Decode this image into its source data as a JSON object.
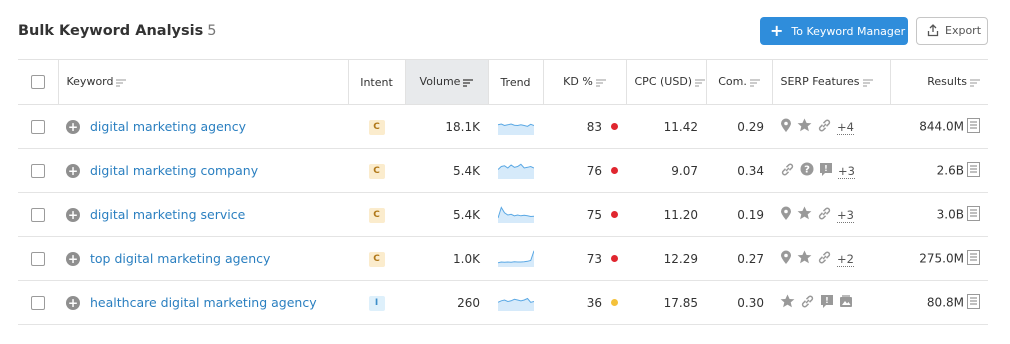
{
  "header": {
    "title": "Bulk Keyword Analysis",
    "count": "5",
    "primary_button": "To Keyword Manager",
    "export_button": "Export"
  },
  "columns": {
    "keyword": "Keyword",
    "intent": "Intent",
    "volume": "Volume",
    "trend": "Trend",
    "kd": "KD %",
    "cpc": "CPC (USD)",
    "com": "Com.",
    "serp": "SERP Features",
    "results": "Results"
  },
  "colors": {
    "accent": "#2f8ddb",
    "link": "#2a7fc0",
    "kd_hard": "#e0262f",
    "kd_medium": "#f4c13a",
    "commercial_bg": "#fbeccd",
    "commercial_fg": "#b07718",
    "informational_bg": "#def0fb",
    "informational_fg": "#3d8ec9"
  },
  "rows": [
    {
      "keyword": "digital marketing agency",
      "intent": "C",
      "volume": "18.1K",
      "trend": [
        0.55,
        0.6,
        0.5,
        0.55,
        0.6,
        0.52,
        0.5,
        0.55,
        0.5,
        0.45,
        0.58,
        0.5
      ],
      "kd": "83",
      "kd_level": "hard",
      "cpc": "11.42",
      "com": "0.29",
      "features": [
        "location-icon",
        "star-icon",
        "link-icon"
      ],
      "more": "+4",
      "results": "844.0M"
    },
    {
      "keyword": "digital marketing company",
      "intent": "C",
      "volume": "5.4K",
      "trend": [
        0.5,
        0.7,
        0.75,
        0.6,
        0.8,
        0.65,
        0.7,
        0.85,
        0.6,
        0.65,
        0.7,
        0.6
      ],
      "kd": "76",
      "kd_level": "hard",
      "cpc": "9.07",
      "com": "0.34",
      "features": [
        "link-icon",
        "help-icon",
        "faq-icon"
      ],
      "more": "+3",
      "results": "2.6B"
    },
    {
      "keyword": "digital marketing service",
      "intent": "C",
      "volume": "5.4K",
      "trend": [
        0.2,
        0.9,
        0.55,
        0.4,
        0.45,
        0.35,
        0.4,
        0.35,
        0.38,
        0.35,
        0.3,
        0.32
      ],
      "kd": "75",
      "kd_level": "hard",
      "cpc": "11.20",
      "com": "0.19",
      "features": [
        "location-icon",
        "star-icon",
        "link-icon"
      ],
      "more": "+3",
      "results": "3.0B"
    },
    {
      "keyword": "top digital marketing agency",
      "intent": "C",
      "volume": "1.0K",
      "trend": [
        0.15,
        0.2,
        0.18,
        0.2,
        0.18,
        0.22,
        0.2,
        0.2,
        0.22,
        0.25,
        0.3,
        0.95
      ],
      "kd": "73",
      "kd_level": "hard",
      "cpc": "12.29",
      "com": "0.27",
      "features": [
        "location-icon",
        "star-icon",
        "link-icon"
      ],
      "more": "+2",
      "results": "275.0M"
    },
    {
      "keyword": "healthcare digital marketing agency",
      "intent": "I",
      "volume": "260",
      "trend": [
        0.45,
        0.55,
        0.6,
        0.5,
        0.55,
        0.65,
        0.6,
        0.55,
        0.6,
        0.7,
        0.45,
        0.5
      ],
      "kd": "36",
      "kd_level": "medium",
      "cpc": "17.85",
      "com": "0.30",
      "features": [
        "star-icon",
        "link-icon",
        "faq-icon",
        "image-pack-icon"
      ],
      "more": "",
      "results": "80.8M"
    }
  ]
}
